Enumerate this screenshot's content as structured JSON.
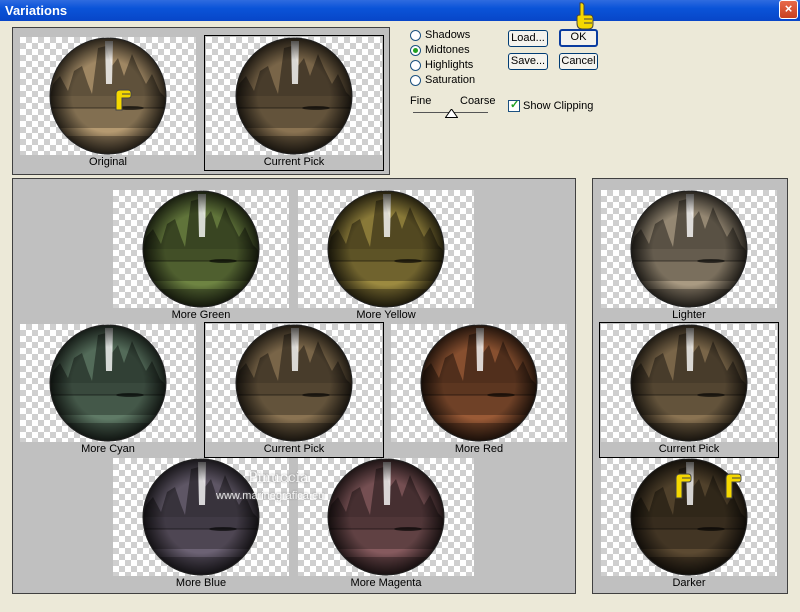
{
  "window": {
    "title": "Variations",
    "close_glyph": "×"
  },
  "modes": [
    {
      "label": "Shadows",
      "selected": false
    },
    {
      "label": "Midtones",
      "selected": true
    },
    {
      "label": "Highlights",
      "selected": false
    },
    {
      "label": "Saturation",
      "selected": false
    }
  ],
  "buttons": {
    "load": "Load...",
    "ok": "OK",
    "save": "Save...",
    "cancel": "Cancel"
  },
  "slider": {
    "fine_label": "Fine",
    "coarse_label": "Coarse",
    "value": 0.5
  },
  "show_clipping": {
    "label": "Show Clipping",
    "checked": true,
    "check_glyph": "✓"
  },
  "top_thumbs": {
    "original": "Original",
    "current": "Current Pick"
  },
  "color_thumbs": {
    "more_green": "More Green",
    "more_yellow": "More Yellow",
    "more_cyan": "More Cyan",
    "current": "Current Pick",
    "more_red": "More Red",
    "more_blue": "More Blue",
    "more_magenta": "More Magenta"
  },
  "light_thumbs": {
    "lighter": "Lighter",
    "current": "Current Pick",
    "darker": "Darker"
  },
  "watermark": {
    "name": "Pinuccia",
    "url": "www.marinegrafica.eu"
  },
  "colors": {
    "titlebar": "#0A53D8",
    "dialog_bg": "#ECE9D8",
    "panel_bg": "#C0C0C0",
    "pointer_icon": "#F5D800",
    "radio_dot": "#21A121"
  }
}
